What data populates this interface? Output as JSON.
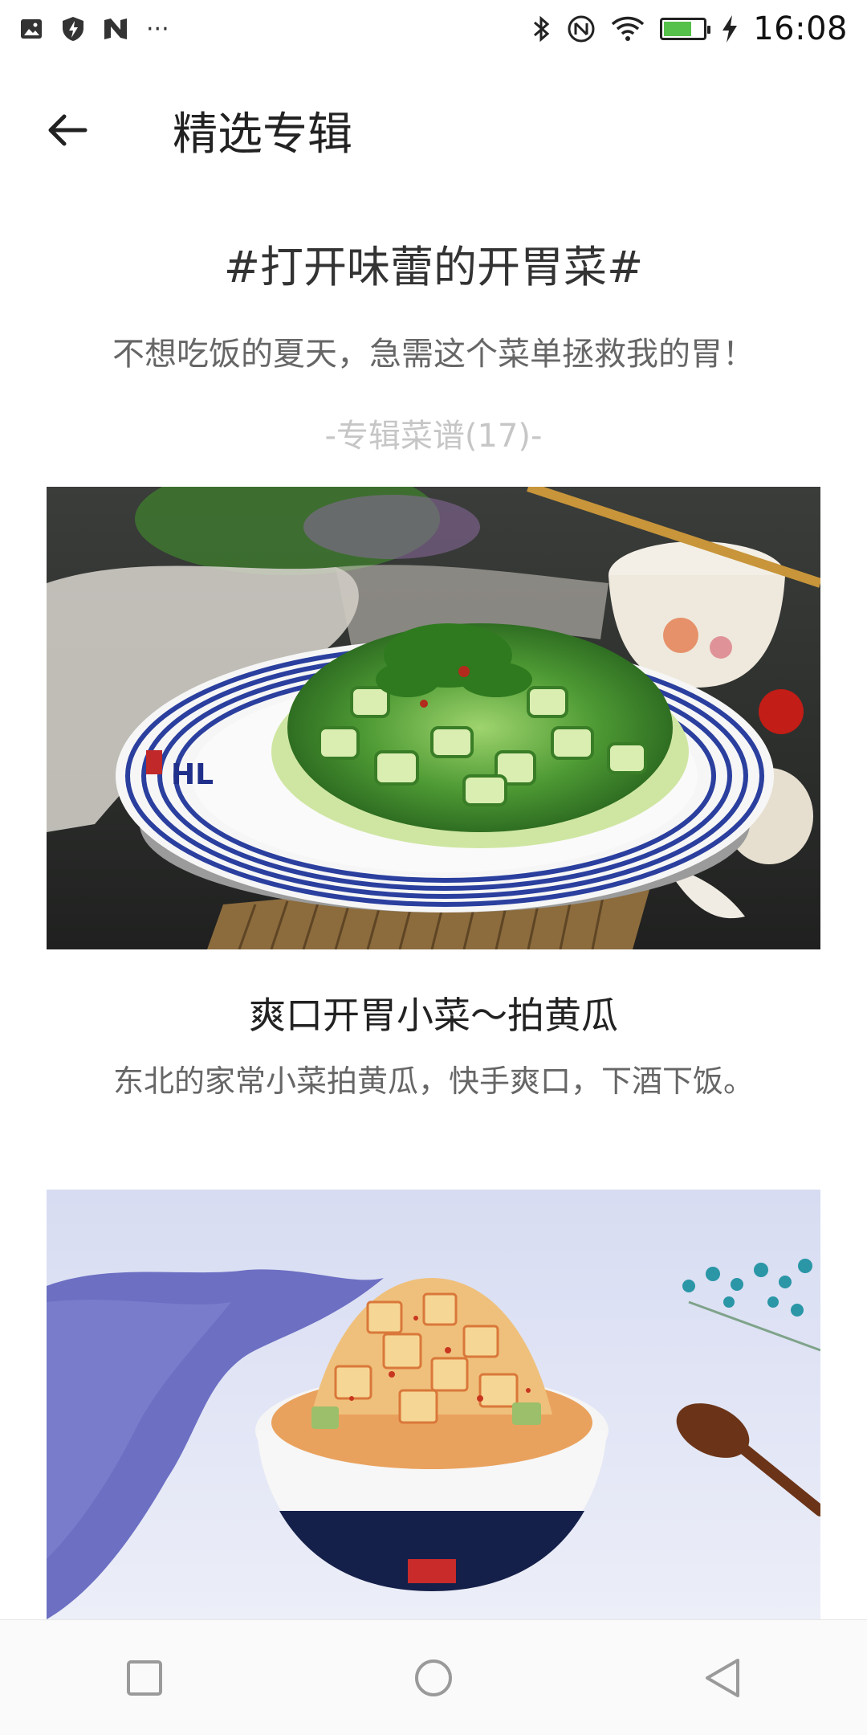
{
  "status_bar": {
    "time": "16:08",
    "left_icons": [
      "image-icon",
      "shield-icon",
      "n-app-icon",
      "more-dots-icon"
    ],
    "right_icons": [
      "bluetooth-icon",
      "nfc-icon",
      "wifi-icon",
      "battery-icon",
      "charging-icon"
    ],
    "more_dots": "···",
    "battery_color": "#55c04a"
  },
  "header": {
    "back_icon": "back-arrow-icon",
    "title": "精选专辑"
  },
  "album": {
    "title": "#打开味蕾的开胃菜#",
    "description": "不想吃饭的夏天，急需这个菜单拯救我的胃！",
    "count_label": "-专辑菜谱(17)-"
  },
  "recipes": [
    {
      "title": "爽口开胃小菜～拍黄瓜",
      "description": "东北的家常小菜拍黄瓜，快手爽口，下酒下饭。"
    },
    {
      "title": "",
      "description": ""
    }
  ],
  "nav_bar": {
    "icons": [
      "recent-apps-icon",
      "home-icon",
      "back-triangle-icon"
    ]
  }
}
